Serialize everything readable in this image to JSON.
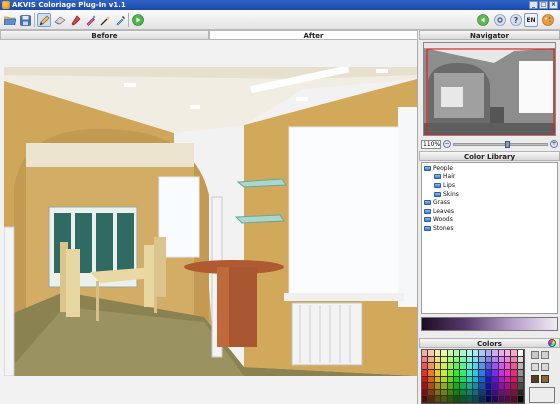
{
  "window": {
    "title": "AKVIS Coloriage Plug-In v1.1"
  },
  "toolbar": {
    "left_icons": [
      "open-icon",
      "save-icon",
      "pencil-icon",
      "eraser-icon",
      "brush-icon",
      "chalk-icon",
      "magic-wand-icon",
      "eyedropper-icon",
      "run-icon"
    ],
    "right_icons": [
      "back-icon",
      "settings-icon",
      "help-icon"
    ],
    "language": "EN"
  },
  "tabs": [
    {
      "label": "Before"
    },
    {
      "label": "After"
    }
  ],
  "navigator": {
    "title": "Navigator",
    "zoom": "110%"
  },
  "color_library": {
    "title": "Color Library",
    "items": [
      {
        "label": "People",
        "level": 0
      },
      {
        "label": "Hair",
        "level": 1
      },
      {
        "label": "Lips",
        "level": 1
      },
      {
        "label": "Skins",
        "level": 1
      },
      {
        "label": "Grass",
        "level": 0
      },
      {
        "label": "Leaves",
        "level": 0
      },
      {
        "label": "Woods",
        "level": 0
      },
      {
        "label": "Stones",
        "level": 0
      }
    ]
  },
  "colors_panel": {
    "title": "Colors"
  },
  "accent": {
    "title_bar": "#2354b8",
    "folder": "#4a8ad6"
  }
}
